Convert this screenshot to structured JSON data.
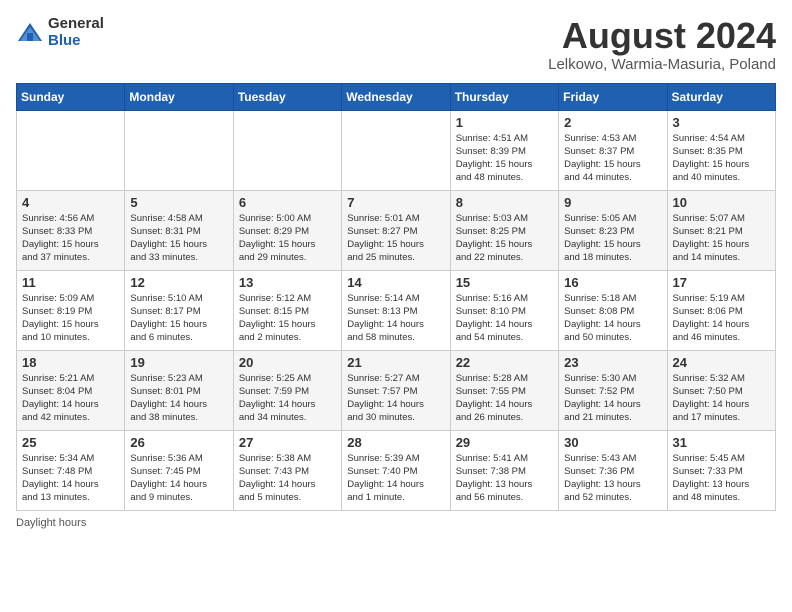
{
  "logo": {
    "general": "General",
    "blue": "Blue"
  },
  "title": "August 2024",
  "subtitle": "Lelkowo, Warmia-Masuria, Poland",
  "days_header": [
    "Sunday",
    "Monday",
    "Tuesday",
    "Wednesday",
    "Thursday",
    "Friday",
    "Saturday"
  ],
  "footer": "Daylight hours",
  "weeks": [
    [
      {
        "day": "",
        "info": ""
      },
      {
        "day": "",
        "info": ""
      },
      {
        "day": "",
        "info": ""
      },
      {
        "day": "",
        "info": ""
      },
      {
        "day": "1",
        "info": "Sunrise: 4:51 AM\nSunset: 8:39 PM\nDaylight: 15 hours\nand 48 minutes."
      },
      {
        "day": "2",
        "info": "Sunrise: 4:53 AM\nSunset: 8:37 PM\nDaylight: 15 hours\nand 44 minutes."
      },
      {
        "day": "3",
        "info": "Sunrise: 4:54 AM\nSunset: 8:35 PM\nDaylight: 15 hours\nand 40 minutes."
      }
    ],
    [
      {
        "day": "4",
        "info": "Sunrise: 4:56 AM\nSunset: 8:33 PM\nDaylight: 15 hours\nand 37 minutes."
      },
      {
        "day": "5",
        "info": "Sunrise: 4:58 AM\nSunset: 8:31 PM\nDaylight: 15 hours\nand 33 minutes."
      },
      {
        "day": "6",
        "info": "Sunrise: 5:00 AM\nSunset: 8:29 PM\nDaylight: 15 hours\nand 29 minutes."
      },
      {
        "day": "7",
        "info": "Sunrise: 5:01 AM\nSunset: 8:27 PM\nDaylight: 15 hours\nand 25 minutes."
      },
      {
        "day": "8",
        "info": "Sunrise: 5:03 AM\nSunset: 8:25 PM\nDaylight: 15 hours\nand 22 minutes."
      },
      {
        "day": "9",
        "info": "Sunrise: 5:05 AM\nSunset: 8:23 PM\nDaylight: 15 hours\nand 18 minutes."
      },
      {
        "day": "10",
        "info": "Sunrise: 5:07 AM\nSunset: 8:21 PM\nDaylight: 15 hours\nand 14 minutes."
      }
    ],
    [
      {
        "day": "11",
        "info": "Sunrise: 5:09 AM\nSunset: 8:19 PM\nDaylight: 15 hours\nand 10 minutes."
      },
      {
        "day": "12",
        "info": "Sunrise: 5:10 AM\nSunset: 8:17 PM\nDaylight: 15 hours\nand 6 minutes."
      },
      {
        "day": "13",
        "info": "Sunrise: 5:12 AM\nSunset: 8:15 PM\nDaylight: 15 hours\nand 2 minutes."
      },
      {
        "day": "14",
        "info": "Sunrise: 5:14 AM\nSunset: 8:13 PM\nDaylight: 14 hours\nand 58 minutes."
      },
      {
        "day": "15",
        "info": "Sunrise: 5:16 AM\nSunset: 8:10 PM\nDaylight: 14 hours\nand 54 minutes."
      },
      {
        "day": "16",
        "info": "Sunrise: 5:18 AM\nSunset: 8:08 PM\nDaylight: 14 hours\nand 50 minutes."
      },
      {
        "day": "17",
        "info": "Sunrise: 5:19 AM\nSunset: 8:06 PM\nDaylight: 14 hours\nand 46 minutes."
      }
    ],
    [
      {
        "day": "18",
        "info": "Sunrise: 5:21 AM\nSunset: 8:04 PM\nDaylight: 14 hours\nand 42 minutes."
      },
      {
        "day": "19",
        "info": "Sunrise: 5:23 AM\nSunset: 8:01 PM\nDaylight: 14 hours\nand 38 minutes."
      },
      {
        "day": "20",
        "info": "Sunrise: 5:25 AM\nSunset: 7:59 PM\nDaylight: 14 hours\nand 34 minutes."
      },
      {
        "day": "21",
        "info": "Sunrise: 5:27 AM\nSunset: 7:57 PM\nDaylight: 14 hours\nand 30 minutes."
      },
      {
        "day": "22",
        "info": "Sunrise: 5:28 AM\nSunset: 7:55 PM\nDaylight: 14 hours\nand 26 minutes."
      },
      {
        "day": "23",
        "info": "Sunrise: 5:30 AM\nSunset: 7:52 PM\nDaylight: 14 hours\nand 21 minutes."
      },
      {
        "day": "24",
        "info": "Sunrise: 5:32 AM\nSunset: 7:50 PM\nDaylight: 14 hours\nand 17 minutes."
      }
    ],
    [
      {
        "day": "25",
        "info": "Sunrise: 5:34 AM\nSunset: 7:48 PM\nDaylight: 14 hours\nand 13 minutes."
      },
      {
        "day": "26",
        "info": "Sunrise: 5:36 AM\nSunset: 7:45 PM\nDaylight: 14 hours\nand 9 minutes."
      },
      {
        "day": "27",
        "info": "Sunrise: 5:38 AM\nSunset: 7:43 PM\nDaylight: 14 hours\nand 5 minutes."
      },
      {
        "day": "28",
        "info": "Sunrise: 5:39 AM\nSunset: 7:40 PM\nDaylight: 14 hours\nand 1 minute."
      },
      {
        "day": "29",
        "info": "Sunrise: 5:41 AM\nSunset: 7:38 PM\nDaylight: 13 hours\nand 56 minutes."
      },
      {
        "day": "30",
        "info": "Sunrise: 5:43 AM\nSunset: 7:36 PM\nDaylight: 13 hours\nand 52 minutes."
      },
      {
        "day": "31",
        "info": "Sunrise: 5:45 AM\nSunset: 7:33 PM\nDaylight: 13 hours\nand 48 minutes."
      }
    ]
  ]
}
